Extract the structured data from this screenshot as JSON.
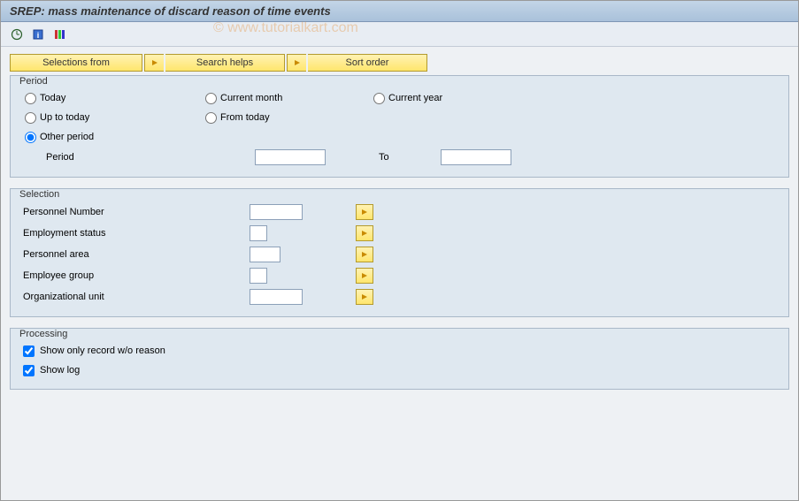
{
  "title": "SREP: mass maintenance of discard reason of time events",
  "watermark": "© www.tutorialkart.com",
  "buttons": {
    "selections_from": "Selections from",
    "search_helps": "Search helps",
    "sort_order": "Sort order"
  },
  "period": {
    "legend": "Period",
    "today": "Today",
    "current_month": "Current month",
    "current_year": "Current year",
    "up_to_today": "Up to today",
    "from_today": "From today",
    "other_period": "Other period",
    "period_label": "Period",
    "period_from": "",
    "to_label": "To",
    "period_to": ""
  },
  "selection": {
    "legend": "Selection",
    "rows": [
      {
        "label": "Personnel Number",
        "value": "",
        "width": "w60"
      },
      {
        "label": "Employment status",
        "value": "",
        "width": "w20"
      },
      {
        "label": "Personnel area",
        "value": "",
        "width": "w35"
      },
      {
        "label": "Employee group",
        "value": "",
        "width": "w20"
      },
      {
        "label": "Organizational unit",
        "value": "",
        "width": "w60"
      }
    ]
  },
  "processing": {
    "legend": "Processing",
    "show_only": "Show only record w/o reason",
    "show_log": "Show log"
  }
}
